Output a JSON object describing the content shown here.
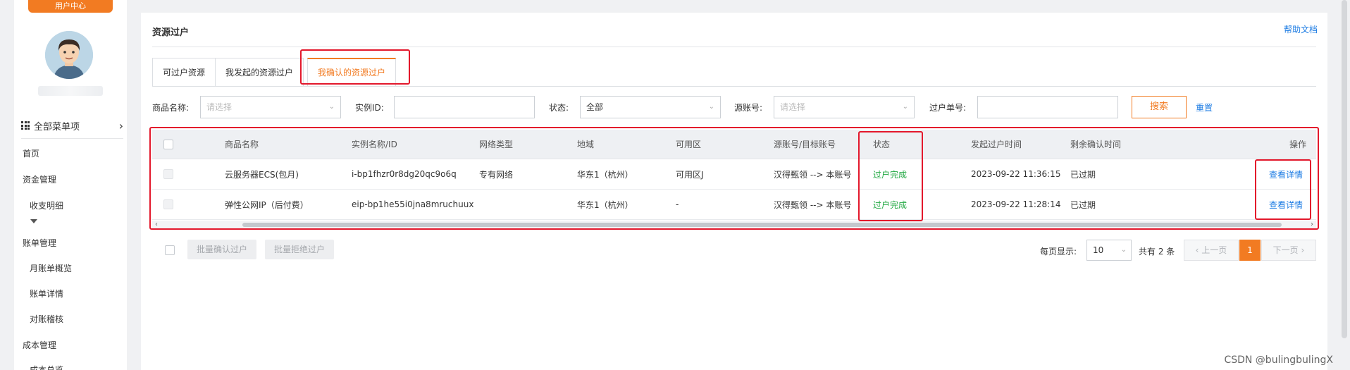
{
  "sidebar": {
    "badge": "用户中心",
    "all_menu": "全部菜单项",
    "items": [
      {
        "label": "首页"
      },
      {
        "label": "资金管理"
      },
      {
        "label": "收支明细"
      },
      {
        "label": "账单管理"
      },
      {
        "label": "月账单概览"
      },
      {
        "label": "账单详情"
      },
      {
        "label": "对账稽核"
      },
      {
        "label": "成本管理"
      },
      {
        "label": "成本总览"
      }
    ]
  },
  "header": {
    "title": "资源过户",
    "help": "帮助文档"
  },
  "tabs": [
    {
      "label": "可过户资源"
    },
    {
      "label": "我发起的资源过户"
    },
    {
      "label": "我确认的资源过户"
    }
  ],
  "filters": {
    "product_label": "商品名称:",
    "product_placeholder": "请选择",
    "instance_label": "实例ID:",
    "instance_value": "",
    "status_label": "状态:",
    "status_value": "全部",
    "source_label": "源账号:",
    "source_placeholder": "请选择",
    "order_label": "过户单号:",
    "order_value": "",
    "search_label": "搜索",
    "reset_label": "重置"
  },
  "table": {
    "columns": [
      "商品名称",
      "实例名称/ID",
      "网络类型",
      "地域",
      "可用区",
      "源账号/目标账号",
      "状态",
      "发起过户时间",
      "剩余确认时间",
      "操作"
    ],
    "rows": [
      {
        "product": "云服务器ECS(包月)",
        "instance": "i-bp1fhzr0r8dg20qc9o6q",
        "network": "专有网络",
        "region": "华东1（杭州）",
        "zone": "可用区J",
        "accounts": "汉得甄领 --> 本账号",
        "status": "过户完成",
        "time": "2023-09-22 11:36:15",
        "remaining": "已过期",
        "action": "查看详情"
      },
      {
        "product": "弹性公网IP（后付费）",
        "instance": "eip-bp1he55i0jna8mruchuux",
        "network": "",
        "region": "华东1（杭州）",
        "zone": "-",
        "accounts": "汉得甄领 --> 本账号",
        "status": "过户完成",
        "time": "2023-09-22 11:28:14",
        "remaining": "已过期",
        "action": "查看详情"
      }
    ]
  },
  "footer": {
    "batch_confirm": "批量确认过户",
    "batch_reject": "批量拒绝过户",
    "per_page_label": "每页显示:",
    "per_page_value": "10",
    "total": "共有 2 条",
    "prev": "上一页",
    "current_page": "1",
    "next": "下一页"
  },
  "watermark": "CSDN @bulingbulingX",
  "colors": {
    "accent": "#f27b22",
    "link": "#1d7ce3",
    "success": "#22a943",
    "highlight": "#e3182c"
  }
}
